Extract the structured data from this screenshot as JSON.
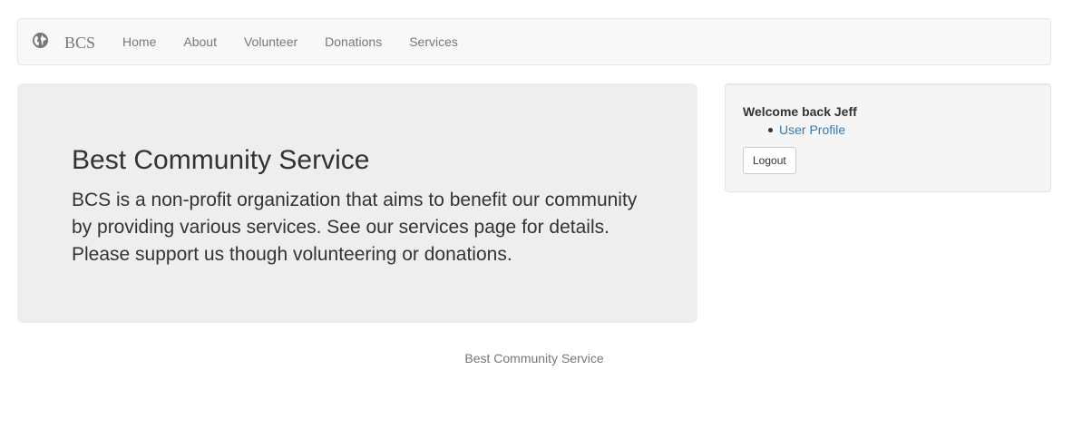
{
  "navbar": {
    "brand_icon": "globe-icon",
    "brand": "BCS",
    "links": [
      "Home",
      "About",
      "Volunteer",
      "Donations",
      "Services"
    ]
  },
  "jumbotron": {
    "title": "Best Community Service",
    "body": "BCS is a non-profit organization that aims to benefit our community by providing various services. See our services page for details. Please support us though volunteering or donations."
  },
  "sidebar": {
    "welcome": "Welcome back Jeff",
    "links": [
      "User Profile"
    ],
    "logout_label": "Logout"
  },
  "footer": {
    "text": "Best Community Service"
  },
  "colors": {
    "navbar_bg": "#f8f8f8",
    "jumbotron_bg": "#eeeeee",
    "link": "#337ab7",
    "muted": "#777777"
  }
}
